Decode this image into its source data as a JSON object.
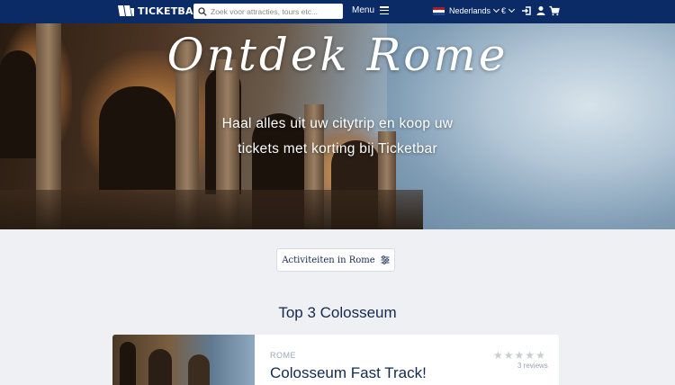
{
  "navbar": {
    "logo_text": "TICKETBAR",
    "search_placeholder": "Zoek voor attracties, tours etc...",
    "menu_label": "Menu",
    "language": "Nederlands",
    "currency": "€",
    "icons": [
      "sign-in-icon",
      "user-icon",
      "cart-icon"
    ]
  },
  "hero": {
    "title": "Ontdek Rome",
    "subtitle": "Haal alles uit uw citytrip en koop uw tickets met korting bij Ticketbar"
  },
  "activities_button": {
    "label": "Activiteiten in Rome",
    "icon": "sliders-icon"
  },
  "section": {
    "title": "Top 3 Colosseum"
  },
  "card": {
    "city": "ROME",
    "title": "Colosseum Fast Track!",
    "rating": 0,
    "reviews": "3 reviews"
  },
  "colors": {
    "navbar": "#0b2b66",
    "text_primary": "#14294f",
    "page_bg": "#eef0f4"
  }
}
